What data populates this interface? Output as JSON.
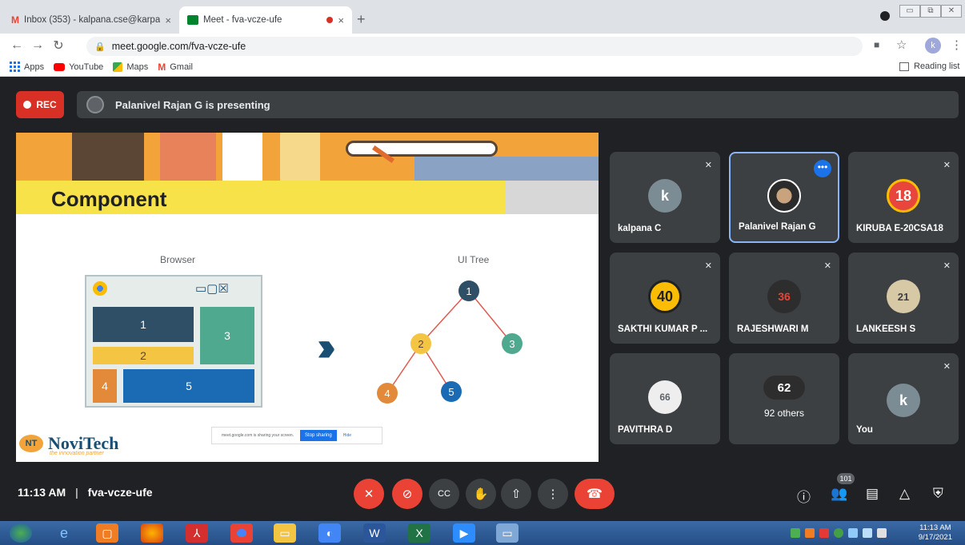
{
  "browser": {
    "tabs": [
      {
        "title": "Inbox (353) - kalpana.cse@karpa",
        "close": "×"
      },
      {
        "title": "Meet - fva-vcze-ufe",
        "close": "×"
      }
    ],
    "new_tab": "+",
    "url": "meet.google.com/fva-vcze-ufe",
    "profile_initial": "k",
    "bookmarks": {
      "apps": "Apps",
      "youtube": "YouTube",
      "maps": "Maps",
      "gmail": "Gmail"
    },
    "reading_list": "Reading list"
  },
  "meet": {
    "rec_label": "REC",
    "presenting_text": "Palanivel Rajan G is presenting",
    "meeting_time": "11:13 AM",
    "separator": "|",
    "meeting_code": "fva-vcze-ufe",
    "participant_count": "101"
  },
  "slide": {
    "title": "Component",
    "browser_label": "Browser",
    "tree_label": "UI Tree",
    "boxes": [
      "1",
      "2",
      "3",
      "4",
      "5"
    ],
    "tree_nodes": [
      "1",
      "2",
      "3",
      "4",
      "5"
    ],
    "share_text": "meet.google.com is sharing your screen.",
    "stop_sharing": "Stop sharing",
    "hide": "Hide",
    "brand_name": "NoviTech",
    "brand_tagline": "the innovation partner",
    "brand_logo": "NT"
  },
  "tiles": [
    {
      "name": "kalpana C",
      "avatar": "k",
      "color": "#7c8c94"
    },
    {
      "name": "Palanivel Rajan G",
      "avatar": "",
      "color": "#5f6368"
    },
    {
      "name": "KIRUBA E-20CSA18",
      "avatar": "18",
      "color": "#e8453c"
    },
    {
      "name": "SAKTHI KUMAR P ...",
      "avatar": "40",
      "color": "#fbbc04"
    },
    {
      "name": "RAJESHWARI M",
      "avatar": "36",
      "color": "#2d2d2d"
    },
    {
      "name": "LANKEESH S",
      "avatar": "21",
      "color": "#d7c8a6"
    },
    {
      "name": "PAVITHRA D",
      "avatar": "66",
      "color": "#eeeeee"
    },
    {
      "name": "92 others",
      "avatar": "62",
      "color": "#2d2d2d"
    },
    {
      "name": "You",
      "avatar": "k",
      "color": "#7c8c94"
    }
  ],
  "taskbar": {
    "time": "11:13 AM",
    "date": "9/17/2021"
  }
}
